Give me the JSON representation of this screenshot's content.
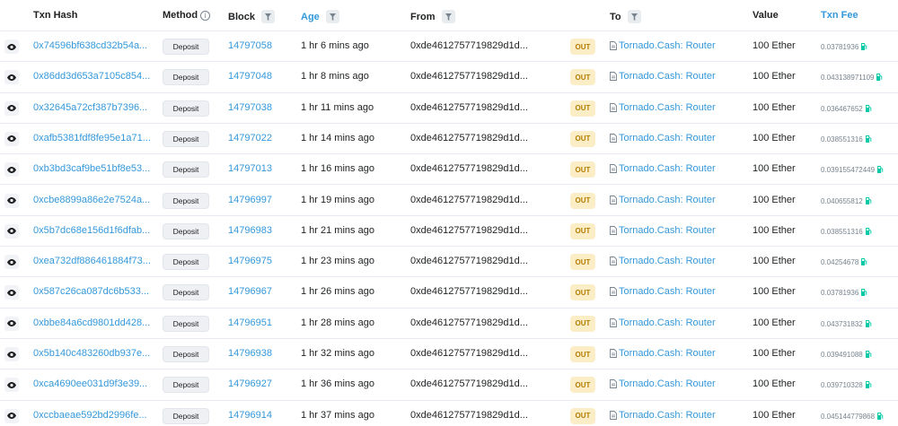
{
  "header": {
    "txn_hash": "Txn Hash",
    "method": "Method",
    "block": "Block",
    "age": "Age",
    "from": "From",
    "to": "To",
    "value": "Value",
    "txn_fee": "Txn Fee",
    "info_glyph": "i"
  },
  "rows": [
    {
      "hash": "0x74596bf638cd32b54a...",
      "method": "Deposit",
      "block": "14797058",
      "age": "1 hr 6 mins ago",
      "from": "0xde4612757719829d1d...",
      "dir": "OUT",
      "to": "Tornado.Cash: Router",
      "value": "100 Ether",
      "fee": "0.03781936"
    },
    {
      "hash": "0x86dd3d653a7105c854...",
      "method": "Deposit",
      "block": "14797048",
      "age": "1 hr 8 mins ago",
      "from": "0xde4612757719829d1d...",
      "dir": "OUT",
      "to": "Tornado.Cash: Router",
      "value": "100 Ether",
      "fee": "0.043138971109"
    },
    {
      "hash": "0x32645a72cf387b7396...",
      "method": "Deposit",
      "block": "14797038",
      "age": "1 hr 11 mins ago",
      "from": "0xde4612757719829d1d...",
      "dir": "OUT",
      "to": "Tornado.Cash: Router",
      "value": "100 Ether",
      "fee": "0.036467652"
    },
    {
      "hash": "0xafb5381fdf8fe95e1a71...",
      "method": "Deposit",
      "block": "14797022",
      "age": "1 hr 14 mins ago",
      "from": "0xde4612757719829d1d...",
      "dir": "OUT",
      "to": "Tornado.Cash: Router",
      "value": "100 Ether",
      "fee": "0.038551316"
    },
    {
      "hash": "0xb3bd3caf9be51bf8e53...",
      "method": "Deposit",
      "block": "14797013",
      "age": "1 hr 16 mins ago",
      "from": "0xde4612757719829d1d...",
      "dir": "OUT",
      "to": "Tornado.Cash: Router",
      "value": "100 Ether",
      "fee": "0.039155472449"
    },
    {
      "hash": "0xcbe8899a86e2e7524a...",
      "method": "Deposit",
      "block": "14796997",
      "age": "1 hr 19 mins ago",
      "from": "0xde4612757719829d1d...",
      "dir": "OUT",
      "to": "Tornado.Cash: Router",
      "value": "100 Ether",
      "fee": "0.040655812"
    },
    {
      "hash": "0x5b7dc68e156d1f6dfab...",
      "method": "Deposit",
      "block": "14796983",
      "age": "1 hr 21 mins ago",
      "from": "0xde4612757719829d1d...",
      "dir": "OUT",
      "to": "Tornado.Cash: Router",
      "value": "100 Ether",
      "fee": "0.038551316"
    },
    {
      "hash": "0xea732df886461884f73...",
      "method": "Deposit",
      "block": "14796975",
      "age": "1 hr 23 mins ago",
      "from": "0xde4612757719829d1d...",
      "dir": "OUT",
      "to": "Tornado.Cash: Router",
      "value": "100 Ether",
      "fee": "0.04254678"
    },
    {
      "hash": "0x587c26ca087dc6b533...",
      "method": "Deposit",
      "block": "14796967",
      "age": "1 hr 26 mins ago",
      "from": "0xde4612757719829d1d...",
      "dir": "OUT",
      "to": "Tornado.Cash: Router",
      "value": "100 Ether",
      "fee": "0.03781936"
    },
    {
      "hash": "0xbbe84a6cd9801dd428...",
      "method": "Deposit",
      "block": "14796951",
      "age": "1 hr 28 mins ago",
      "from": "0xde4612757719829d1d...",
      "dir": "OUT",
      "to": "Tornado.Cash: Router",
      "value": "100 Ether",
      "fee": "0.043731832"
    },
    {
      "hash": "0x5b140c483260db937e...",
      "method": "Deposit",
      "block": "14796938",
      "age": "1 hr 32 mins ago",
      "from": "0xde4612757719829d1d...",
      "dir": "OUT",
      "to": "Tornado.Cash: Router",
      "value": "100 Ether",
      "fee": "0.039491088"
    },
    {
      "hash": "0xca4690ee031d9f3e39...",
      "method": "Deposit",
      "block": "14796927",
      "age": "1 hr 36 mins ago",
      "from": "0xde4612757719829d1d...",
      "dir": "OUT",
      "to": "Tornado.Cash: Router",
      "value": "100 Ether",
      "fee": "0.039710328"
    },
    {
      "hash": "0xccbaeae592bd2996fe...",
      "method": "Deposit",
      "block": "14796914",
      "age": "1 hr 37 mins ago",
      "from": "0xde4612757719829d1d...",
      "dir": "OUT",
      "to": "Tornado.Cash: Router",
      "value": "100 Ether",
      "fee": "0.045144779868"
    }
  ],
  "colors": {
    "link": "#3498db",
    "out_bg": "#fbedc6",
    "out_text": "#b47d00",
    "gas_icon": "#00c9a7"
  },
  "icons": {
    "row_action": "eye-icon",
    "to_type": "document-icon",
    "fee_gas": "gas-pump-icon",
    "header_filter": "filter-icon"
  }
}
